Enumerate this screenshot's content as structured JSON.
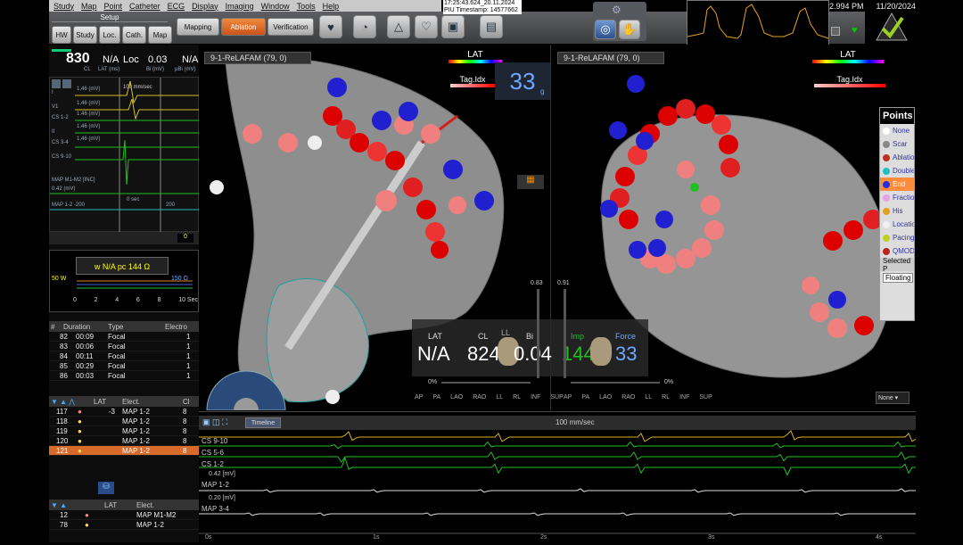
{
  "menu": [
    "Study",
    "Map",
    "Point",
    "Catheter",
    "ECG",
    "Display",
    "Imaging",
    "Window",
    "Tools",
    "Help"
  ],
  "setup": {
    "label": "Setup",
    "buttons": [
      "HW",
      "Study",
      "Loc.",
      "Cath.",
      "Map"
    ]
  },
  "modes": {
    "mapping": "Mapping",
    "ablation": "Ablation",
    "verification": "Verification"
  },
  "timestamp": {
    "line1": "17:25:43.624_20.11.2024",
    "line2": "PIU Timestamp: 14577662"
  },
  "clock": {
    "time": "2.994 PM",
    "date": "11/20/2024"
  },
  "cl_panel": {
    "cl": "830",
    "cl_unit": "CL",
    "lat": "N/A",
    "lat_unit": "LAT (ms)",
    "loc": "Loc",
    "bi": "0.03",
    "bi_unit": "Bi (mV)",
    "na": "N/A",
    "ubi_unit": "µBi (mV)"
  },
  "ecg": {
    "speed": "100 mm/sec",
    "time_label": "0 sec",
    "time_200": "200",
    "channels": [
      "I",
      "V1",
      "CS 1-2",
      "II",
      "CS 3-4",
      "CS 9-10",
      "MAP M1-M2 [INC]",
      "MAP 1-2 -200"
    ],
    "scales": [
      "1.46 (mV)",
      "1.46 (mV)",
      "1.46 (mV)",
      "1.46 (mV)",
      "1.46 (mV)",
      "0.42 (mV)"
    ],
    "counter": "0"
  },
  "signal": {
    "header": "w N/A pc 144 Ω",
    "left_scale": "50 W",
    "right_scale": "150 Ω",
    "axis": [
      "0",
      "2",
      "4",
      "6",
      "8",
      "10 Sec"
    ]
  },
  "ablation_table": {
    "headers": [
      "#",
      "Duration",
      "Type",
      "Electro"
    ],
    "rows": [
      [
        "82",
        "00:09",
        "Focal",
        "1"
      ],
      [
        "83",
        "00:06",
        "Focal",
        "1"
      ],
      [
        "84",
        "00:11",
        "Focal",
        "1"
      ],
      [
        "85",
        "00:29",
        "Focal",
        "1"
      ],
      [
        "86",
        "00:03",
        "Focal",
        "1"
      ]
    ]
  },
  "points_table": {
    "headers": [
      "LAT",
      "Elect.",
      "Cl"
    ],
    "rows": [
      [
        "117",
        "-3",
        "MAP 1-2",
        "8"
      ],
      [
        "118",
        "",
        "MAP 1-2",
        "8"
      ],
      [
        "119",
        "",
        "MAP 1-2",
        "8"
      ],
      [
        "120",
        "",
        "MAP 1-2",
        "8"
      ],
      [
        "121",
        "",
        "MAP 1-2",
        "8"
      ]
    ],
    "selected": "121"
  },
  "tag_table": {
    "headers": [
      "LAT",
      "Elect."
    ],
    "rows": [
      [
        "12",
        "MAP M1-M2"
      ],
      [
        "78",
        "MAP 1-2"
      ]
    ]
  },
  "map_left": {
    "name": "9-1-ReLAFAM (79, 0)",
    "legend": "LAT",
    "tag": "Tag.Idx",
    "tag_value": "33",
    "tag_sub": "g"
  },
  "map_right": {
    "name": "9-1-ReLAFAM (79, 0)",
    "legend": "LAT",
    "tag": "Tag.Idx"
  },
  "points_panel": {
    "title": "Points",
    "items": [
      {
        "label": "None",
        "color": "#ffffff"
      },
      {
        "label": "Scar",
        "color": "#888888"
      },
      {
        "label": "Ablation",
        "color": "#c03020"
      },
      {
        "label": "Double",
        "color": "#20c0c0"
      },
      {
        "label": "End",
        "color": "#2030e0"
      },
      {
        "label": "Fractionated",
        "color": "#e8a0e8"
      },
      {
        "label": "His",
        "color": "#e0a020"
      },
      {
        "label": "Location",
        "color": "#f0f0f0"
      },
      {
        "label": "Pacing",
        "color": "#c0d020"
      },
      {
        "label": "QMODE",
        "color": "#c02020"
      }
    ],
    "highlighted": "End",
    "selected": "Selected P",
    "floating": "Floating"
  },
  "readout": {
    "lat_label": "LAT",
    "lat": "N/A",
    "cl_label": "CL",
    "cl": "824",
    "bi_label": "Bi",
    "bi": "0.04",
    "imp_label": "Imp",
    "imp": "144",
    "force_label": "Force",
    "force": "33",
    "ll": "LL",
    "left_val": "0.83",
    "right_val": "0.91"
  },
  "views": [
    "AP",
    "PA",
    "LAO",
    "RAO",
    "LL",
    "RL",
    "INF",
    "SUP"
  ],
  "pct": [
    "0%",
    "0%"
  ],
  "select_none": "None",
  "bottom": {
    "timeline": "Timeline",
    "speed": "100 mm/sec",
    "tracks": [
      "CS 9-10",
      "CS 5-6",
      "CS 1-2",
      "MAP 1-2",
      "MAP 3-4"
    ],
    "scales": [
      "0.42 [mV]",
      "0.20 [mV]"
    ],
    "ticks": [
      "0s",
      "1s",
      "2s",
      "3s",
      "4s"
    ]
  },
  "colors": {
    "accent": "#d86a2a",
    "map_bg": "#000000",
    "lat_blue": "#2030e0",
    "red": "#e01010"
  }
}
